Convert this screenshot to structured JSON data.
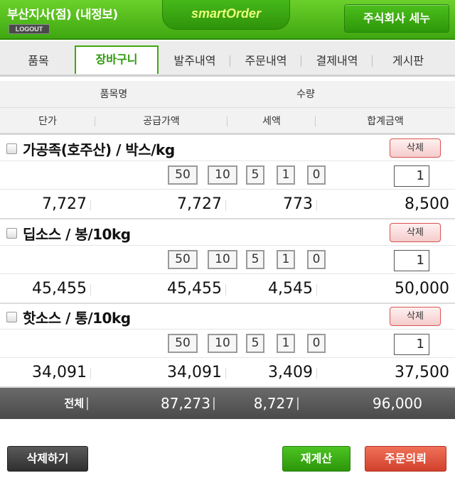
{
  "header": {
    "branch_name": "부산지사(점) (내정보)",
    "logout_label": "LOGOUT",
    "logo_text": "smartOrder",
    "company_button": "주식회사 세누"
  },
  "tabs": [
    "품목",
    "장바구니",
    "발주내역",
    "주문내역",
    "결제내역",
    "게시판"
  ],
  "active_tab": "장바구니",
  "table_header": {
    "item_name": "품목명",
    "quantity": "수량",
    "unit_price": "단가",
    "supply_amount": "공급가액",
    "tax": "세액",
    "total_amount": "합계금액"
  },
  "quick_qty_buttons": [
    "50",
    "10",
    "5",
    "1",
    "0"
  ],
  "delete_label": "삭제",
  "items": [
    {
      "name": "가공족(호주산) / 박스/kg",
      "qty": "1",
      "unit_price": "7,727",
      "supply": "7,727",
      "tax": "773",
      "total": "8,500"
    },
    {
      "name": "딥소스 / 봉/10kg",
      "qty": "1",
      "unit_price": "45,455",
      "supply": "45,455",
      "tax": "4,545",
      "total": "50,000"
    },
    {
      "name": "핫소스 / 통/10kg",
      "qty": "1",
      "unit_price": "34,091",
      "supply": "34,091",
      "tax": "3,409",
      "total": "37,500"
    }
  ],
  "totals": {
    "label": "전체",
    "supply": "87,273",
    "tax": "8,727",
    "total": "96,000",
    "separator": "|"
  },
  "buttons": {
    "delete_all": "삭제하기",
    "recalculate": "재계산",
    "order_request": "주문의뢰"
  },
  "colors": {
    "brand_green": "#3fa811",
    "logo_text": "#e9ff7a",
    "total_bar": "#555555",
    "order_button": "#d1412c"
  }
}
